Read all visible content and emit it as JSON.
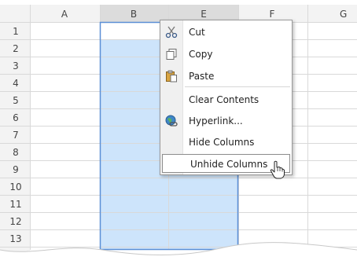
{
  "spreadsheet": {
    "column_headers": [
      "A",
      "B",
      "E",
      "F",
      "G"
    ],
    "row_headers": [
      "1",
      "2",
      "3",
      "4",
      "5",
      "6",
      "7",
      "8",
      "9",
      "10",
      "11",
      "12",
      "13"
    ],
    "selected_columns": [
      "B",
      "E"
    ],
    "colors": {
      "selection_fill": "#cde4fb",
      "selection_border": "#5b8fd6",
      "header_fill": "#f3f3f3",
      "header_selected_fill": "#dcdcdc",
      "grid_line": "#d9d9d9"
    }
  },
  "context_menu": {
    "items": [
      {
        "label": "Cut",
        "icon": "scissors-icon"
      },
      {
        "label": "Copy",
        "icon": "copy-icon"
      },
      {
        "label": "Paste",
        "icon": "paste-icon"
      },
      {
        "label": "Clear Contents",
        "icon": ""
      },
      {
        "label": "Hyperlink...",
        "icon": "hyperlink-icon"
      },
      {
        "label": "Hide Columns",
        "icon": ""
      },
      {
        "label": "Unhide Columns",
        "icon": "",
        "highlighted": true
      }
    ]
  },
  "cursor": {
    "icon": "hand-pointer-icon"
  }
}
